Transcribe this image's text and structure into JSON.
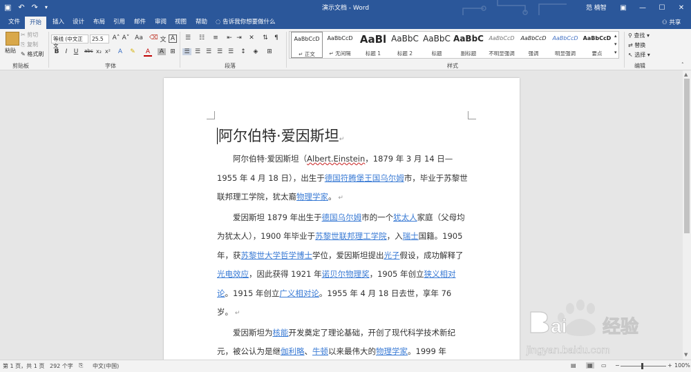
{
  "window": {
    "title": "演示文档 - Word",
    "user": "范 楠智",
    "qat": {
      "save_icon": "save-icon",
      "undo_icon": "undo-icon",
      "redo_icon": "redo-icon",
      "customize_icon": "chevron-down-icon"
    },
    "buttons": {
      "ribbon_display": "▣",
      "minimize": "—",
      "maximize": "☐",
      "close": "✕"
    }
  },
  "tabs": [
    {
      "label": "文件"
    },
    {
      "label": "开始"
    },
    {
      "label": "插入"
    },
    {
      "label": "设计"
    },
    {
      "label": "布局"
    },
    {
      "label": "引用"
    },
    {
      "label": "邮件"
    },
    {
      "label": "审阅"
    },
    {
      "label": "视图"
    },
    {
      "label": "帮助"
    }
  ],
  "tell_me": "告诉我你想要做什么",
  "share": "共享",
  "ribbon": {
    "clipboard": {
      "paste": "粘贴",
      "cut": "剪切",
      "copy": "复制",
      "format_painter": "格式刷",
      "group_label": "剪贴板"
    },
    "font": {
      "font_name": "等线 (中文正文",
      "font_size": "25.5",
      "group_label": "字体"
    },
    "paragraph": {
      "group_label": "段落"
    },
    "styles": {
      "group_label": "样式",
      "items": [
        {
          "sample": "AaBbCcD",
          "label": "↵ 正文"
        },
        {
          "sample": "AaBbCcD",
          "label": "↵ 无间隔"
        },
        {
          "sample": "AaBl",
          "label": "标题 1"
        },
        {
          "sample": "AaBbC",
          "label": "标题 2"
        },
        {
          "sample": "AaBbC",
          "label": "标题"
        },
        {
          "sample": "AaBbC",
          "label": "副标题"
        },
        {
          "sample": "AaBbCcD",
          "label": "不明显强调"
        },
        {
          "sample": "AaBbCcD",
          "label": "强调"
        },
        {
          "sample": "AaBbCcD",
          "label": "明显强调"
        },
        {
          "sample": "AaBbCcD",
          "label": "要点"
        }
      ]
    },
    "editing": {
      "find": "查找",
      "replace": "替换",
      "select": "选择",
      "group_label": "编辑"
    }
  },
  "document": {
    "heading": "阿尔伯特·爱因斯坦",
    "p1": {
      "a": "阿尔伯特·爱因斯坦（",
      "b": "Albert.Einstein",
      "c": "，1879 年 3 月 14 日—1955 年 4 月 18 日），出生于",
      "link1": "德国符腾堡王国乌尔姆",
      "d": "市，毕业于苏黎世联邦理工学院，犹太裔",
      "link2": "物理学家",
      "e": "。"
    },
    "p2": {
      "a": "爱因斯坦 1879 年出生于",
      "link1": "德国乌尔姆",
      "b": "市的一个",
      "link2": "犹太人",
      "c": "家庭（父母均为犹太人），1900 年毕业于",
      "link3": "苏黎世联邦理工学院",
      "d": "，入",
      "link4": "瑞士",
      "e": "国籍。1905 年，获",
      "link5": "苏黎世大学哲学博士",
      "f": "学位，爱因斯坦提出",
      "link6": "光子",
      "g": "假设，成功解释了",
      "link7": "光电效应",
      "h": "，因此获得 1921 年",
      "link8": "诺贝尔物理奖",
      "i": "，1905 年创立",
      "link9": "狭义相对论",
      "j": "。1915 年创立",
      "link10": "广义相对论",
      "k": "。1955 年 4 月 18 日去世，享年 76 岁。"
    },
    "p3": {
      "a": "爱因斯坦为",
      "link1": "核能",
      "b": "开发奠定了理论基础，开创了现代科学技术新纪元，被公认为是继",
      "link2": "伽利略",
      "c": "、",
      "link3": "牛顿",
      "d": "以来最伟大的",
      "link4": "物理学家",
      "e": "。1999 年"
    }
  },
  "statusbar": {
    "page": "第 1 页，共 1 页",
    "words": "292 个字",
    "language": "中文(中国)",
    "zoom": "100%"
  },
  "watermark": {
    "brand": "Bai",
    "brand2": "经验",
    "url": "jingyan.baidu.com"
  },
  "colors": {
    "accent": "#2b579a",
    "link": "#3a7bd5"
  }
}
